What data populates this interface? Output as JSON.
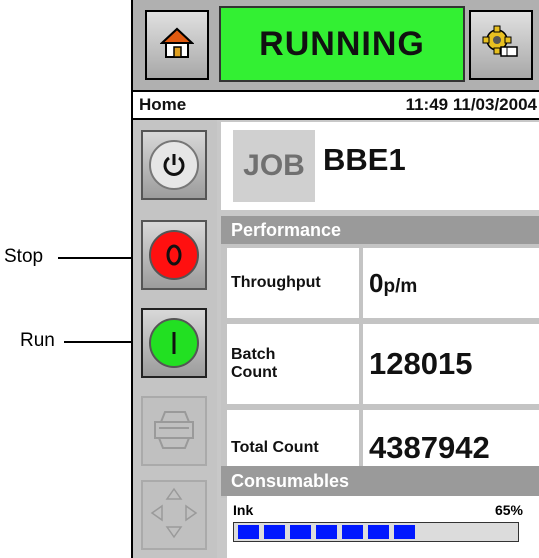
{
  "callouts": {
    "stop": "Stop",
    "run": "Run"
  },
  "topbar": {
    "status": "RUNNING",
    "status_color": "#33f033",
    "home_icon": "home-icon",
    "settings_icon": "settings-gear-icon"
  },
  "subbar": {
    "page": "Home",
    "datetime": "11:49 11/03/2004"
  },
  "sidebar": {
    "buttons": [
      {
        "name": "power",
        "icon": "power-icon",
        "enabled": true
      },
      {
        "name": "stop",
        "icon": "stop-icon",
        "enabled": true,
        "color": "#ff1010"
      },
      {
        "name": "run",
        "icon": "run-icon",
        "enabled": true,
        "color": "#22e022"
      },
      {
        "name": "print",
        "icon": "printer-icon",
        "enabled": false
      },
      {
        "name": "navigate",
        "icon": "navigation-arrows-icon",
        "enabled": false
      }
    ]
  },
  "job": {
    "label": "JOB",
    "name": "BBE1"
  },
  "performance": {
    "title": "Performance",
    "throughput_label": "Throughput",
    "throughput_value": "0",
    "throughput_unit": "p/m",
    "batch_label_1": "Batch",
    "batch_label_2": "Count",
    "batch_value": "128015",
    "total_label": "Total Count",
    "total_value": "4387942"
  },
  "consumables": {
    "title": "Consumables",
    "ink_label": "Ink",
    "ink_percent": "65%",
    "ink_level": 0.65,
    "bar_color": "#0018ff"
  }
}
